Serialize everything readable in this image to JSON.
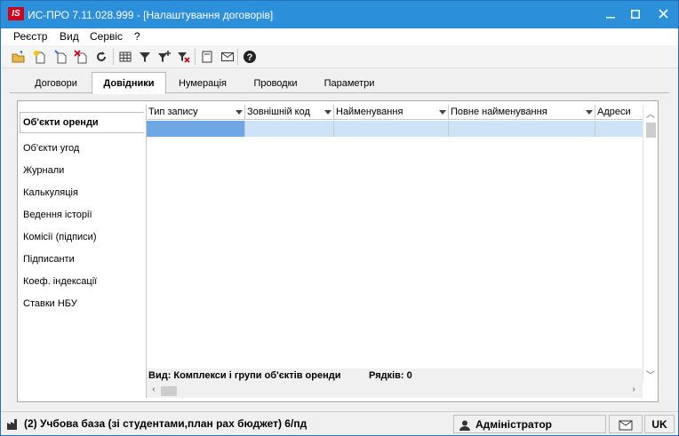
{
  "window": {
    "app_icon": "IS",
    "title": "ИС-ПРО 7.11.028.999 - [Налаштування договорів]",
    "buttons": [
      "minimize",
      "maximize",
      "close"
    ]
  },
  "menu": [
    "Реєстр",
    "Вид",
    "Сервіс",
    "?"
  ],
  "toolbar_icons": [
    "open-folder-icon",
    "new-document-icon",
    "copy-icon",
    "delete-icon",
    "refresh-icon",
    "table-view-icon",
    "filter-icon",
    "filter-add-icon",
    "filter-clear-icon",
    "document-icon",
    "mail-icon",
    "help-icon"
  ],
  "tabs": [
    {
      "label": "Договори",
      "active": false
    },
    {
      "label": "Довідники",
      "active": true
    },
    {
      "label": "Нумерація",
      "active": false
    },
    {
      "label": "Проводки",
      "active": false
    },
    {
      "label": "Параметри",
      "active": false
    }
  ],
  "left_list": [
    "Об'єкти оренди",
    "Об'єкти угод",
    "Журнали",
    "Калькуляція",
    "Ведення історії",
    "Комісії (підписи)",
    "Підписанти",
    "Коеф. індексації",
    "Ставки НБУ"
  ],
  "grid": {
    "columns": [
      "Тип запису",
      "Зовнішній код",
      "Найменування",
      "Повне найменування",
      "Адреси"
    ],
    "footer_view": "Вид: Комплекси і групи об'єктів оренди",
    "footer_rows": "Рядків: 0"
  },
  "status": {
    "database": "(2) Учбова база (зі студентами,план рах бюджет) 6/пд",
    "user": "Адміністратор",
    "language": "UK"
  },
  "colors": {
    "titlebar": "#2b8fd9",
    "row_selected": "#cde3f7",
    "cell_focused": "#6ea7e6"
  }
}
